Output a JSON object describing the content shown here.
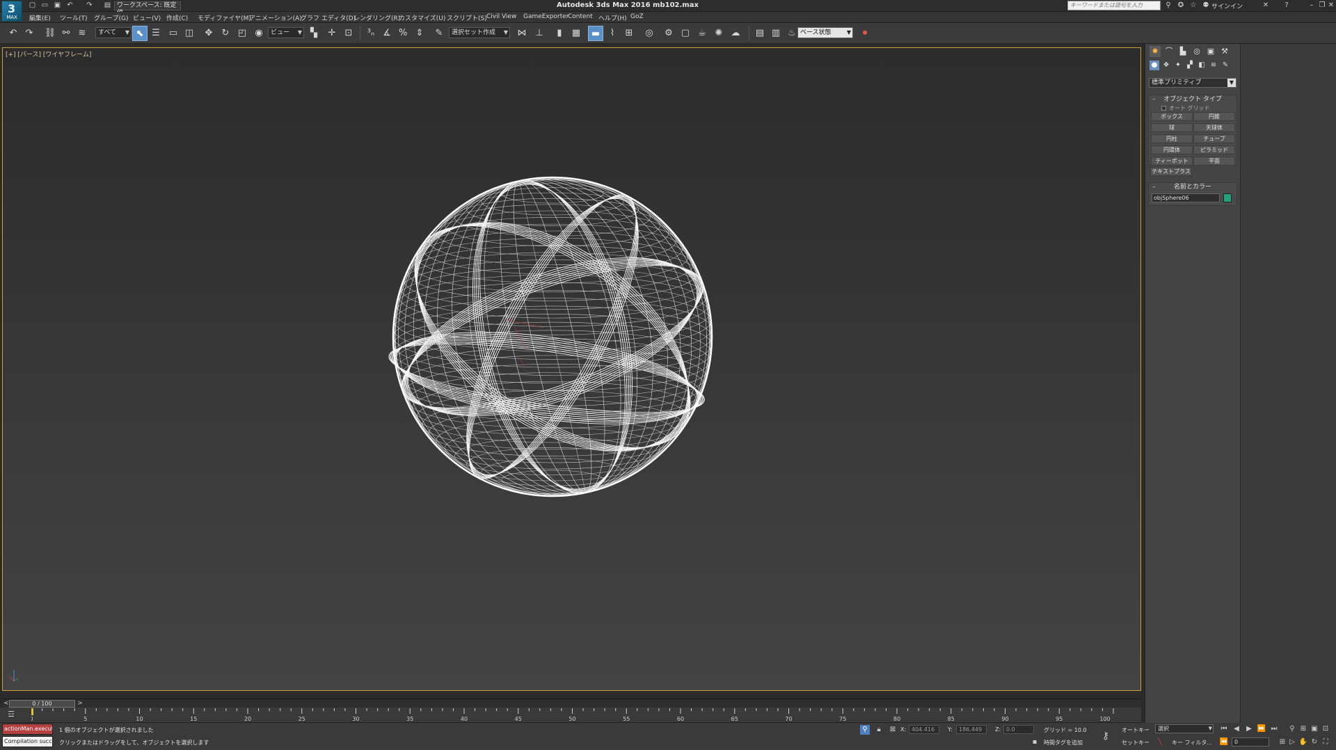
{
  "titlebar": {
    "app_badge": "MAX",
    "workspace": "ワークスペース: 既定値",
    "title": "Autodesk 3ds Max 2016      mb102.max",
    "search_placeholder": "キーワードまたは語句を入力",
    "signin": "サインイン"
  },
  "menu": {
    "items": [
      "編集(E)",
      "ツール(T)",
      "グループ(G)",
      "ビュー(V)",
      "作成(C)",
      "モディファイヤ(M)",
      "アニメーション(A)",
      "グラフ エディタ(D)",
      "レンダリング(R)",
      "カスタマイズ(U)",
      "スクリプト(S)",
      "Civil View",
      "GameExporter",
      "Content",
      "ヘルプ(H)",
      "GoZ"
    ]
  },
  "toolbar": {
    "filter": "すべて",
    "ref_coord": "ビュー",
    "named_sel": "選択セット作成",
    "scene_state": "ベース状態"
  },
  "viewport": {
    "label": "[+] [パース] [ワイヤフレーム]",
    "wire_color": "#ffffff",
    "border_color": "#c8a23a"
  },
  "command_panel": {
    "category": "標準プリミティブ",
    "object_type_title": "オブジェクト タイプ",
    "autogrid": "オート グリッド",
    "buttons": [
      "ボックス",
      "円錐",
      "球",
      "天球体",
      "円柱",
      "チューブ",
      "円環体",
      "ピラミッド",
      "ティーポット",
      "平面",
      "テキストプラス"
    ],
    "name_color_title": "名前とカラー",
    "object_name": "objSphere06",
    "object_color": "#1fa37a"
  },
  "timeline": {
    "frame_readout": "0 / 100",
    "ticks": [
      "0",
      "5",
      "10",
      "15",
      "20",
      "25",
      "30",
      "35",
      "40",
      "45",
      "50",
      "55",
      "60",
      "65",
      "70",
      "75",
      "80",
      "85",
      "90",
      "95",
      "100"
    ]
  },
  "statusbar": {
    "listener_a": "actionMan.execut",
    "listener_b": "Compilation succ",
    "status_1": "1 個のオブジェクトが選択されました",
    "status_2": "クリックまたはドラッグをして、オブジェクトを選択します",
    "x_label": "X:",
    "x_value": "404.416",
    "y_label": "Y:",
    "y_value": "186.449",
    "z_label": "Z:",
    "z_value": "0.0",
    "grid": "グリッド = 10.0",
    "add_time_tag": "時間タグを追加",
    "auto_key": "オートキー",
    "set_key": "セットキー",
    "selection": "選択",
    "key_filters": "キー フィルタ...",
    "frame": "0"
  }
}
